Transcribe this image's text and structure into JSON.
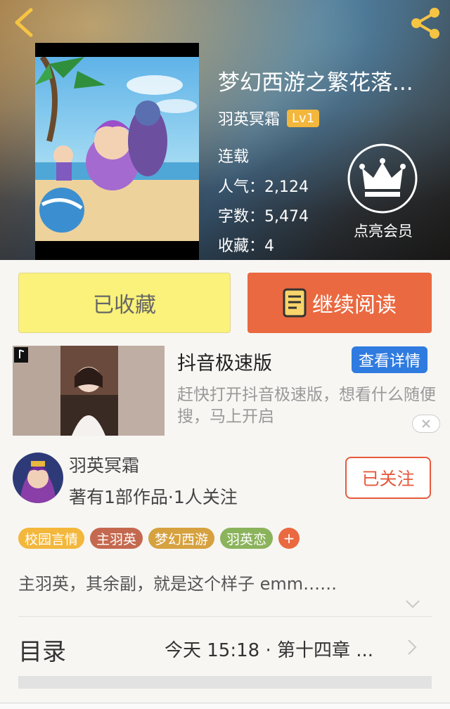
{
  "book": {
    "title": "梦幻西游之繁花落...",
    "author": "羽英冥霜",
    "author_level": "Lv1",
    "status": "连载",
    "popularity": "人气：2,124",
    "word_count": "字数：5,474",
    "favorites": "收藏：4"
  },
  "vip": {
    "label": "点亮会员"
  },
  "actions": {
    "collected_label": "已收藏",
    "read_label": "继续阅读"
  },
  "ad": {
    "title": "抖音极速版",
    "detail_label": "查看详情",
    "description": "赶快打开抖音极速版，想看什么随便搜，马上开启"
  },
  "author_card": {
    "name": "羽英冥霜",
    "meta": "著有1部作品·1人关注",
    "follow_label": "已关注"
  },
  "tags": [
    {
      "label": "校园言情",
      "color": "#f3b73c"
    },
    {
      "label": "主羽英",
      "color": "#c4694f"
    },
    {
      "label": "梦幻西游",
      "color": "#d6a13f"
    },
    {
      "label": "羽英恋",
      "color": "#8bb35c"
    }
  ],
  "tag_plus": "+",
  "intro": "主羽英，其余副，就是这个样子 emm……",
  "toc": {
    "label": "目录",
    "latest": "今天 15:18 · 第十四章 ..."
  },
  "colors": {
    "accent": "#ea6940",
    "ad_button": "#2f7be0",
    "collected_bg": "#faf27a"
  },
  "icons": [
    "back-arrow-icon",
    "share-icon",
    "crown-icon",
    "book-icon",
    "close-icon",
    "chevron-down-icon",
    "chevron-right-icon"
  ]
}
